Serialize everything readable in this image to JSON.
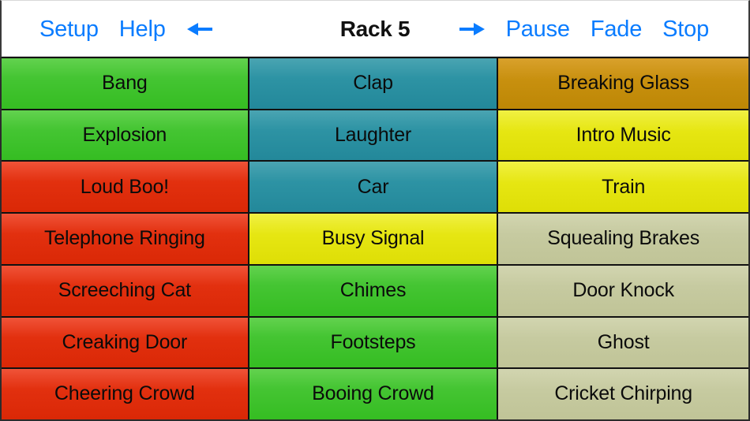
{
  "toolbar": {
    "left_buttons": [
      {
        "label": "Setup",
        "name": "setup-button"
      },
      {
        "label": "Help",
        "name": "help-button"
      }
    ],
    "prev_arrow": {
      "icon": "arrow-left-icon",
      "glyph": "←"
    },
    "next_arrow": {
      "icon": "arrow-right-icon",
      "glyph": "→"
    },
    "title": "Rack 5",
    "right_buttons": [
      {
        "label": "Pause",
        "name": "pause-button"
      },
      {
        "label": "Fade",
        "name": "fade-button"
      },
      {
        "label": "Stop",
        "name": "stop-button"
      }
    ],
    "accent_color": "#0a7cff",
    "title_color": "#111111"
  },
  "colors": {
    "green": "#45c533",
    "teal": "#2d93a4",
    "red": "#e2300f",
    "gold": "#c8900f",
    "yellow": "#e6e612",
    "sage": "#c6caa0",
    "border": "#111111",
    "background": "#ffffff"
  },
  "grid": {
    "columns": 3,
    "rows": 7,
    "cells": [
      {
        "label": "Bang",
        "color": "green"
      },
      {
        "label": "Clap",
        "color": "teal"
      },
      {
        "label": "Breaking Glass",
        "color": "gold"
      },
      {
        "label": "Explosion",
        "color": "green"
      },
      {
        "label": "Laughter",
        "color": "teal"
      },
      {
        "label": "Intro Music",
        "color": "yellow"
      },
      {
        "label": "Loud Boo!",
        "color": "red"
      },
      {
        "label": "Car",
        "color": "teal"
      },
      {
        "label": "Train",
        "color": "yellow"
      },
      {
        "label": "Telephone Ringing",
        "color": "red"
      },
      {
        "label": "Busy Signal",
        "color": "yellow"
      },
      {
        "label": "Squealing Brakes",
        "color": "sage"
      },
      {
        "label": "Screeching Cat",
        "color": "red"
      },
      {
        "label": "Chimes",
        "color": "green"
      },
      {
        "label": "Door Knock",
        "color": "sage"
      },
      {
        "label": "Creaking Door",
        "color": "red"
      },
      {
        "label": "Footsteps",
        "color": "green"
      },
      {
        "label": "Ghost",
        "color": "sage"
      },
      {
        "label": "Cheering Crowd",
        "color": "red"
      },
      {
        "label": "Booing Crowd",
        "color": "green"
      },
      {
        "label": "Cricket Chirping",
        "color": "sage"
      }
    ]
  }
}
